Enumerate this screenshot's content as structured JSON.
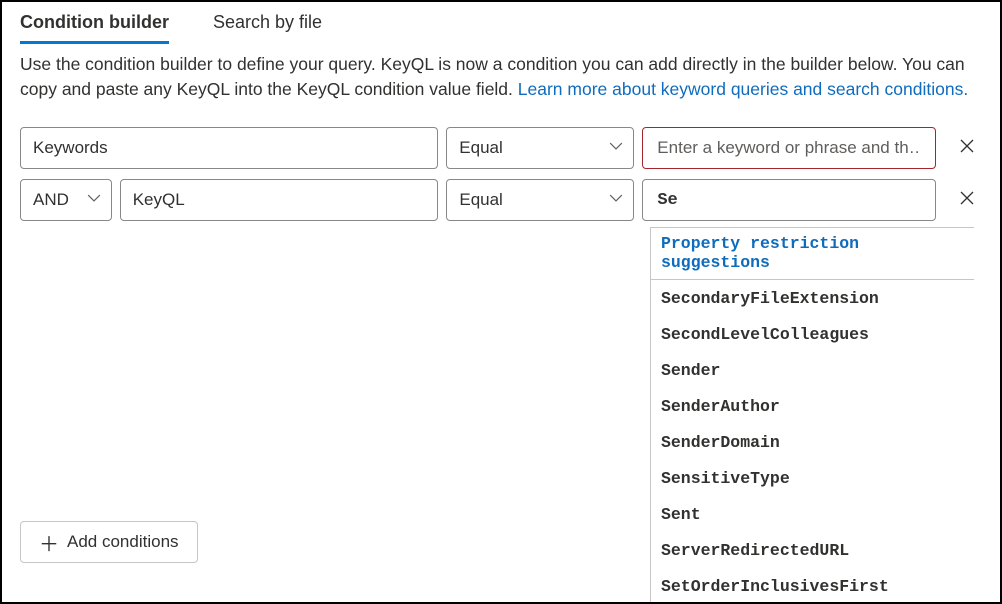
{
  "tabs": {
    "conditionBuilder": "Condition builder",
    "searchByFile": "Search by file"
  },
  "description": {
    "text": "Use the condition builder to define your query. KeyQL is now a condition you can add directly in the builder below. You can copy and paste any KeyQL into the KeyQL condition value field. ",
    "linkText": "Learn more about keyword queries and search conditions."
  },
  "row1": {
    "property": "Keywords",
    "operator": "Equal",
    "valuePlaceholder": "Enter a keyword or phrase and th…"
  },
  "row2": {
    "logic": "AND",
    "property": "KeyQL",
    "operator": "Equal",
    "value": "Se"
  },
  "addConditionsLabel": "Add conditions",
  "suggestions": {
    "header": "Property restriction suggestions",
    "items": [
      "SecondaryFileExtension",
      "SecondLevelColleagues",
      "Sender",
      "SenderAuthor",
      "SenderDomain",
      "SensitiveType",
      "Sent",
      "ServerRedirectedURL",
      "SetOrderInclusivesFirst"
    ]
  }
}
